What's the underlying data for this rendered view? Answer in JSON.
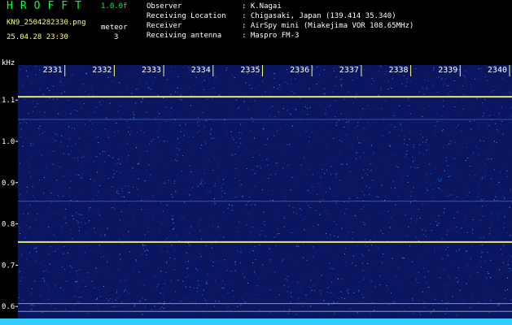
{
  "header": {
    "app_title": "HROFFT",
    "version": "1.0.0f",
    "filename": "KN9_2504282330.png",
    "mode": "meteor",
    "datetime": "25.04.28 23:30",
    "count": "3",
    "meta": [
      {
        "label": "Observer",
        "value": ": K.Nagai"
      },
      {
        "label": "Receiving Location",
        "value": ": Chigasaki, Japan (139.414 35.340)"
      },
      {
        "label": "Receiver",
        "value": ": AirSpy mini (Miakejima VOR 108.65MHz)"
      },
      {
        "label": "Receiving antenna",
        "value": ": Maspro FM-3"
      }
    ]
  },
  "spectrogram": {
    "unit": "kHz",
    "time_labels": [
      "2331",
      "2332",
      "2333",
      "2334",
      "2335",
      "2336",
      "2337",
      "2338",
      "2339",
      "2340"
    ],
    "freq_labels": [
      "1.1",
      "1.0",
      "0.9",
      "0.8",
      "0.7",
      "0.6"
    ],
    "freq_min": 0.555,
    "freq_max": 1.185,
    "line_freqs": [
      1.108,
      1.053,
      0.855,
      0.756
    ],
    "colors": {
      "background": "#0a1660",
      "carrier": "#ffff66",
      "axis_text": "#ffffff",
      "ticks": "#ffff66",
      "noise_floor": "#33ccff"
    }
  }
}
